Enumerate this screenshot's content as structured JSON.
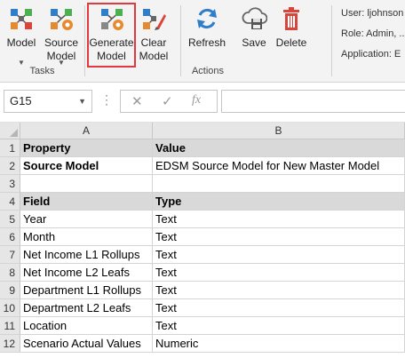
{
  "ribbon": {
    "buttons": {
      "model": {
        "label": "Model"
      },
      "source_model": {
        "label": "Source Model"
      },
      "generate_model": {
        "label": "Generate Model"
      },
      "clear_model": {
        "label": "Clear Model"
      },
      "refresh": {
        "label": "Refresh"
      },
      "save": {
        "label": "Save"
      },
      "delete": {
        "label": "Delete"
      }
    },
    "groups": {
      "tasks": "Tasks",
      "actions": "Actions"
    },
    "user_info": {
      "user": "User: ljohnson",
      "role": "Role: Admin, ...",
      "application": "Application: E"
    },
    "colors": {
      "highlight": "#e0393e",
      "refresh_blue": "#2f7ec9",
      "delete_red": "#d9453b"
    }
  },
  "formula_bar": {
    "name_box": "G15",
    "cancel_symbol": "✕",
    "enter_symbol": "✓",
    "function_symbol": "fx",
    "formula": ""
  },
  "sheet": {
    "columns": [
      "A",
      "B"
    ],
    "rows": [
      {
        "num": "1",
        "a": "Property",
        "b": "Value"
      },
      {
        "num": "2",
        "a": "Source Model",
        "b": "EDSM Source Model for New Master Model"
      },
      {
        "num": "3",
        "a": "",
        "b": ""
      },
      {
        "num": "4",
        "a": "Field",
        "b": "Type"
      },
      {
        "num": "5",
        "a": "Year",
        "b": "Text"
      },
      {
        "num": "6",
        "a": "Month",
        "b": "Text"
      },
      {
        "num": "7",
        "a": "Net Income L1 Rollups",
        "b": "Text"
      },
      {
        "num": "8",
        "a": "Net Income L2 Leafs",
        "b": "Text"
      },
      {
        "num": "9",
        "a": "Department L1 Rollups",
        "b": "Text"
      },
      {
        "num": "10",
        "a": "Department L2 Leafs",
        "b": "Text"
      },
      {
        "num": "11",
        "a": "Location",
        "b": "Text"
      },
      {
        "num": "12",
        "a": "Scenario Actual Values",
        "b": "Numeric"
      }
    ]
  }
}
